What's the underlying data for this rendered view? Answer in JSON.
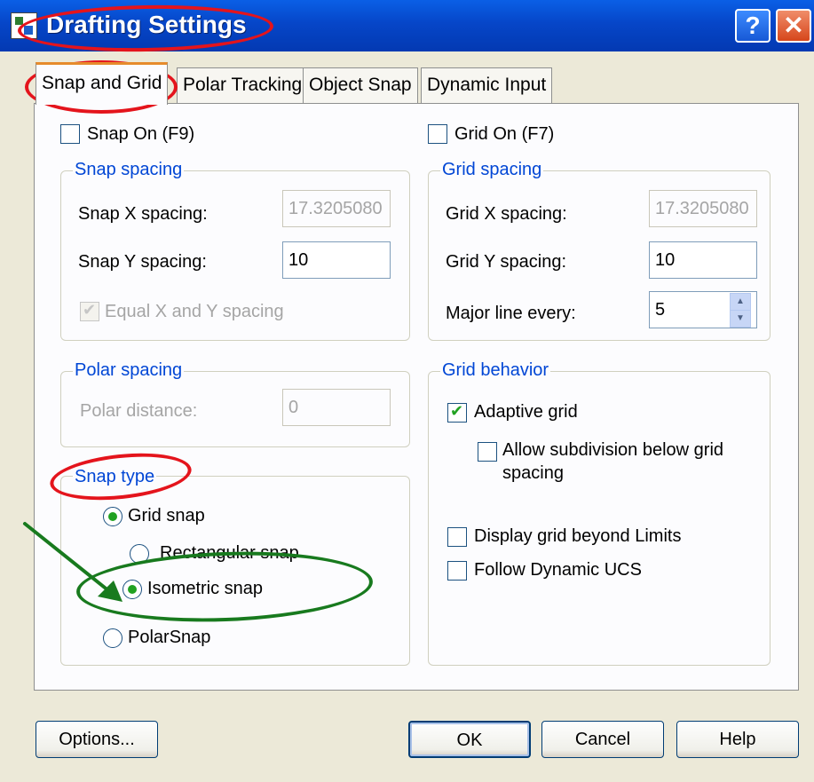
{
  "window": {
    "title": "Drafting Settings",
    "help_glyph": "?",
    "close_glyph": "✕"
  },
  "tabs": [
    {
      "label": "Snap and Grid",
      "active": true
    },
    {
      "label": "Polar Tracking",
      "active": false
    },
    {
      "label": "Object Snap",
      "active": false
    },
    {
      "label": "Dynamic Input",
      "active": false
    }
  ],
  "snap": {
    "snap_on_label": "Snap On (F9)",
    "snap_on": false,
    "spacing_group": "Snap spacing",
    "x_label": "Snap X spacing:",
    "x_value": "17.3205080",
    "y_label": "Snap Y spacing:",
    "y_value": "10",
    "equal_label": "Equal X and Y spacing",
    "equal_checked": true
  },
  "polar": {
    "group": "Polar spacing",
    "distance_label": "Polar distance:",
    "distance_value": "0"
  },
  "snap_type": {
    "group": "Snap type",
    "grid_snap": "Grid snap",
    "rectangular": "Rectangular snap",
    "isometric": "Isometric snap",
    "polarsnap": "PolarSnap",
    "selected": "isometric"
  },
  "grid": {
    "grid_on_label": "Grid On (F7)",
    "grid_on": false,
    "spacing_group": "Grid spacing",
    "x_label": "Grid X spacing:",
    "x_value": "17.3205080",
    "y_label": "Grid Y spacing:",
    "y_value": "10",
    "major_label": "Major line every:",
    "major_value": "5"
  },
  "behavior": {
    "group": "Grid behavior",
    "adaptive": "Adaptive grid",
    "adaptive_checked": true,
    "subdivision": "Allow subdivision below grid",
    "subdivision_line2": "spacing",
    "subdivision_checked": false,
    "beyond_limits": "Display grid beyond Limits",
    "beyond_checked": false,
    "dynamic_ucs": "Follow Dynamic UCS",
    "dynamic_checked": false
  },
  "buttons": {
    "options": "Options...",
    "ok": "OK",
    "cancel": "Cancel",
    "help": "Help"
  },
  "annotation_colors": {
    "red": "#e4141c",
    "green": "#187a1e"
  }
}
